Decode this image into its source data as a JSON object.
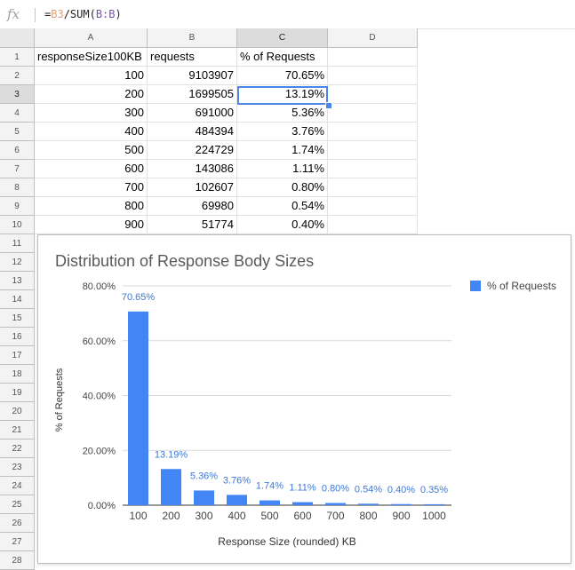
{
  "formula_bar": {
    "icon": "fx-icon",
    "formula_parts": [
      "=",
      "B3",
      "/SUM(",
      "B:B",
      ")"
    ]
  },
  "columns": [
    "A",
    "B",
    "C",
    "D"
  ],
  "rows": [
    "1",
    "2",
    "3",
    "4",
    "5",
    "6",
    "7",
    "8",
    "9",
    "10",
    "11",
    "12",
    "13",
    "14",
    "15",
    "16",
    "17",
    "18",
    "19",
    "20",
    "21",
    "22",
    "23",
    "24",
    "25",
    "26",
    "27",
    "28"
  ],
  "table": {
    "header": [
      "responseSize100KB",
      "requests",
      "% of Requests"
    ],
    "rows": [
      [
        "100",
        "9103907",
        "70.65%"
      ],
      [
        "200",
        "1699505",
        "13.19%"
      ],
      [
        "300",
        "691000",
        "5.36%"
      ],
      [
        "400",
        "484394",
        "3.76%"
      ],
      [
        "500",
        "224729",
        "1.74%"
      ],
      [
        "600",
        "143086",
        "1.11%"
      ],
      [
        "700",
        "102607",
        "0.80%"
      ],
      [
        "800",
        "69980",
        "0.54%"
      ],
      [
        "900",
        "51774",
        "0.40%"
      ]
    ]
  },
  "selection": {
    "active_cell": "C3",
    "active_column": "C",
    "active_row": "3"
  },
  "colors": {
    "bar": "#4285f4",
    "label": "#3c78d8",
    "selection": "#4a86e8"
  },
  "chart_data": {
    "type": "bar",
    "title": "Distribution of Response Body Sizes",
    "xlabel": "Response Size (rounded) KB",
    "ylabel": "% of Requests",
    "categories": [
      "100",
      "200",
      "300",
      "400",
      "500",
      "600",
      "700",
      "800",
      "900",
      "1000"
    ],
    "series": [
      {
        "name": "% of Requests",
        "values": [
          70.65,
          13.19,
          5.36,
          3.76,
          1.74,
          1.11,
          0.8,
          0.54,
          0.4,
          0.35
        ],
        "labels": [
          "70.65%",
          "13.19%",
          "5.36%",
          "3.76%",
          "1.74%",
          "1.11%",
          "0.80%",
          "0.54%",
          "0.40%",
          "0.35%"
        ]
      }
    ],
    "yticks": [
      "0.00%",
      "20.00%",
      "40.00%",
      "60.00%",
      "80.00%"
    ],
    "ytick_values": [
      0,
      20,
      40,
      60,
      80
    ],
    "ylim": [
      0,
      80
    ],
    "legend": "top-right",
    "grid": true
  }
}
